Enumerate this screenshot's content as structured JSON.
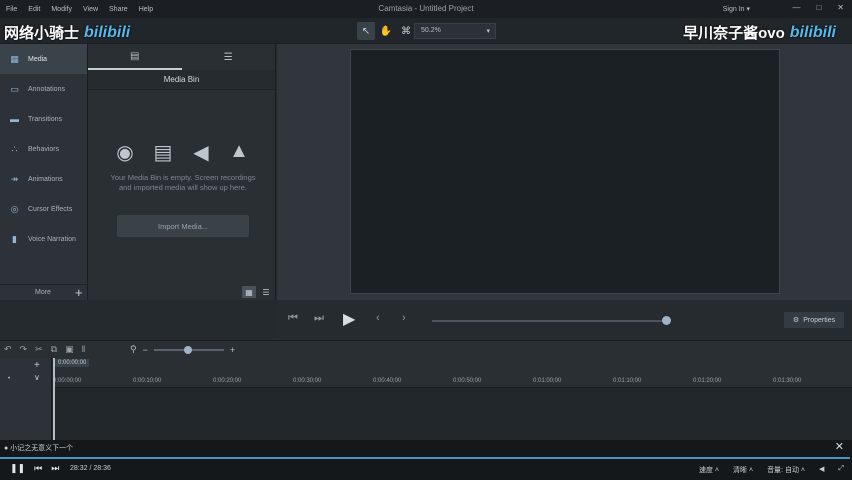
{
  "app": {
    "title": "Camtasia - Untitled Project",
    "menu": [
      "File",
      "Edit",
      "Modify",
      "View",
      "Share",
      "Help"
    ],
    "sign_in": "Sign In ▾",
    "window_controls": [
      "—",
      "□",
      "✕"
    ]
  },
  "toolbar": {
    "zoom_value": "50.2%"
  },
  "watermark": {
    "left_text": "网络小骑士",
    "left_logo": "bilibili",
    "right_text": "早川奈子酱ovo",
    "right_logo": "bilibili"
  },
  "sidenav": {
    "items": [
      {
        "label": "Media",
        "icon": "media-icon"
      },
      {
        "label": "Annotations",
        "icon": "annotation-icon"
      },
      {
        "label": "Transitions",
        "icon": "transition-icon"
      },
      {
        "label": "Behaviors",
        "icon": "behavior-icon"
      },
      {
        "label": "Animations",
        "icon": "animation-icon"
      },
      {
        "label": "Cursor Effects",
        "icon": "cursor-icon"
      },
      {
        "label": "Voice Narration",
        "icon": "microphone-icon"
      }
    ],
    "more_label": "More",
    "add_label": "+"
  },
  "media_bin": {
    "heading": "Media Bin",
    "empty_text": "Your Media Bin is empty. Screen recordings and imported media will show up here.",
    "import_label": "Import Media..."
  },
  "playback": {
    "properties_label": "Properties"
  },
  "timeline": {
    "playhead_time": "0:00:00;00",
    "ticks": [
      "0:00:00;00",
      "0:00:10;00",
      "0:00:20;00",
      "0:00:30;00",
      "0:00:40;00",
      "0:00:50;00",
      "0:01:00;00",
      "0:01:10;00",
      "0:01:20;00",
      "0:01:30;00"
    ]
  },
  "video_player": {
    "title": "● 小记之无意义下一个",
    "time": "28:32 / 28:36",
    "right_controls": [
      "速度 ˄",
      "清晰 ˄",
      "音量: 自动 ˄"
    ],
    "progress": 0.998
  }
}
